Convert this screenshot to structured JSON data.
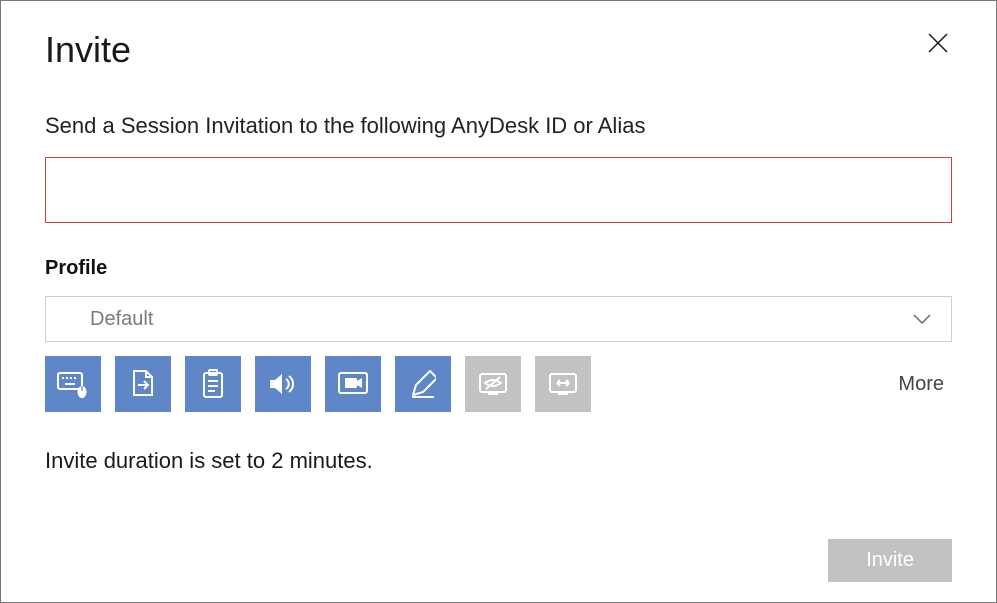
{
  "dialog": {
    "title": "Invite",
    "instruction": "Send a Session Invitation to the following AnyDesk ID or Alias",
    "id_input": {
      "value": "",
      "placeholder": ""
    },
    "profile": {
      "label": "Profile",
      "selected": "Default"
    },
    "permissions": [
      {
        "name": "keyboard-mouse",
        "enabled": true
      },
      {
        "name": "file-transfer",
        "enabled": true
      },
      {
        "name": "clipboard",
        "enabled": true
      },
      {
        "name": "audio",
        "enabled": true
      },
      {
        "name": "video",
        "enabled": true
      },
      {
        "name": "draw",
        "enabled": true
      },
      {
        "name": "privacy",
        "enabled": false
      },
      {
        "name": "switch-sides",
        "enabled": false
      }
    ],
    "more_label": "More",
    "duration_text": "Invite duration is set to 2 minutes.",
    "submit_label": "Invite",
    "colors": {
      "accent": "#5f86c7",
      "error_border": "#d04040",
      "disabled": "#c2c2c2"
    }
  }
}
